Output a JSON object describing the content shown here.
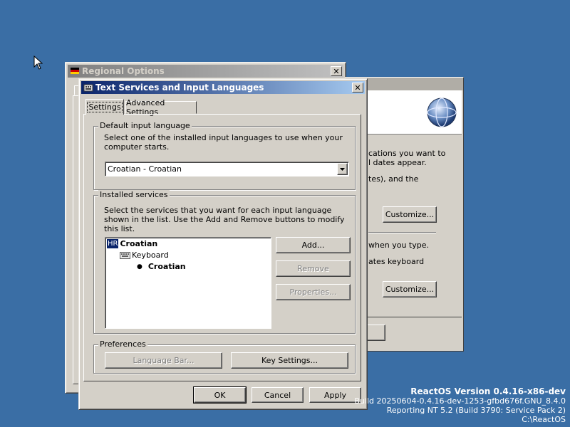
{
  "regional_options": {
    "title": "Regional Options",
    "text_lines": [
      "cations you want to",
      "l dates appear.",
      "tes), and the",
      "when you type.",
      "ates keyboard"
    ],
    "customize_label": "Customize..."
  },
  "dialog": {
    "title": "Text Services and Input Languages",
    "tabs": [
      "Settings",
      "Advanced Settings"
    ],
    "default_group": {
      "label": "Default input language",
      "description": "Select one of the installed input languages to use when your computer starts.",
      "selected": "Croatian - Croatian"
    },
    "installed_group": {
      "label": "Installed services",
      "description": "Select the services that you want for each input language shown in the list. Use the Add and Remove buttons to modify this list.",
      "tree": {
        "language_badge": "HR",
        "language": "Croatian",
        "category": "Keyboard",
        "layout": "Croatian"
      },
      "add_label": "Add...",
      "remove_label": "Remove",
      "properties_label": "Properties..."
    },
    "preferences_group": {
      "label": "Preferences",
      "language_bar_label": "Language Bar...",
      "key_settings_label": "Key Settings..."
    },
    "ok_label": "OK",
    "cancel_label": "Cancel",
    "apply_label": "Apply"
  },
  "desktop": {
    "version": "ReactOS Version 0.4.16-x86-dev",
    "build": "Build 20250604-0.4.16-dev-1253-gfbd676f.GNU_8.4.0",
    "reporting": "Reporting NT 5.2 (Build 3790: Service Pack 2)",
    "path": "C:\\ReactOS"
  },
  "icons": [
    "cursor-arrow-icon",
    "flag-icon",
    "globe-icon",
    "keyboard-icon",
    "close-icon",
    "dropdown-arrow-icon"
  ]
}
